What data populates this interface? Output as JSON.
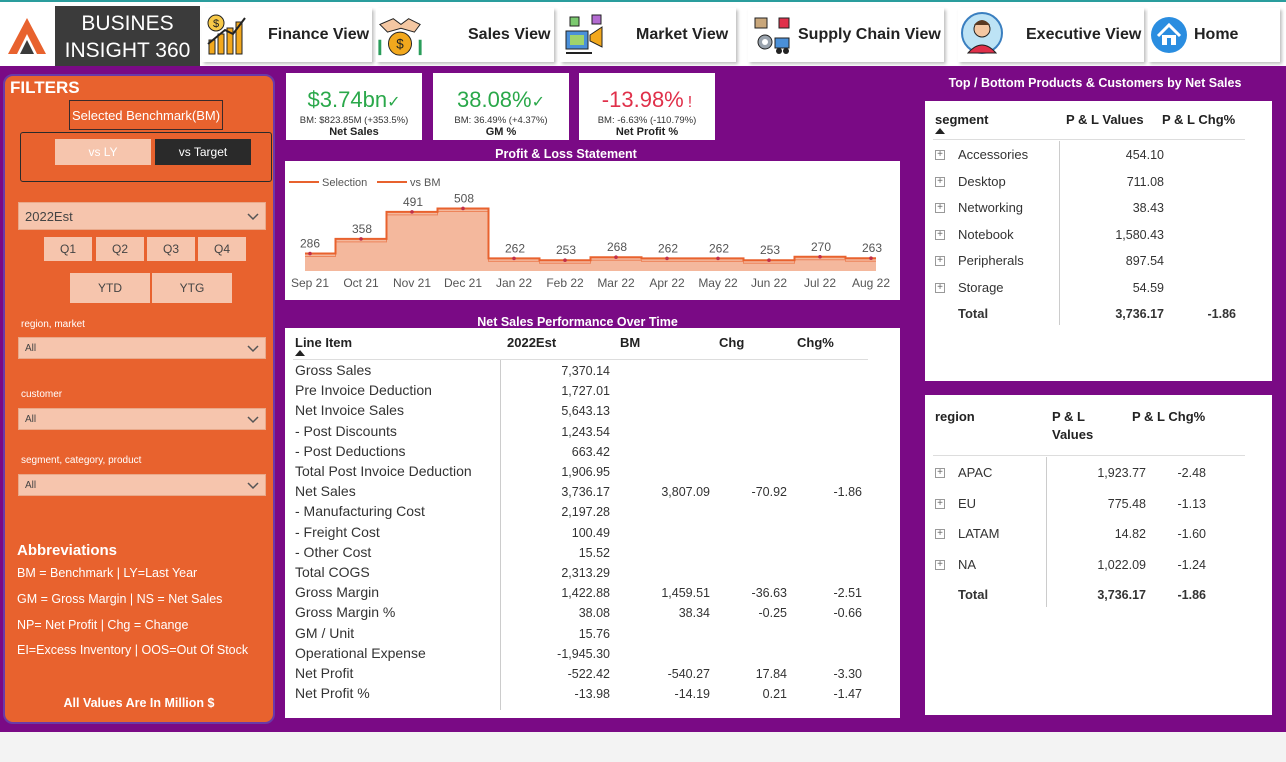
{
  "app": {
    "brand_line1": "BUSINES",
    "brand_line2": "INSIGHT 360",
    "logo_icon": "logo-a-icon"
  },
  "nav": [
    {
      "label": "Finance View",
      "icon": "finance-chart-icon"
    },
    {
      "label": "Sales View",
      "icon": "handshake-coin-icon"
    },
    {
      "label": "Market View",
      "icon": "market-icon"
    },
    {
      "label": "Supply Chain View",
      "icon": "supply-chain-icon"
    },
    {
      "label": "Executive View",
      "icon": "executive-icon"
    },
    {
      "label": "Home",
      "icon": "home-icon"
    }
  ],
  "filters": {
    "title": "FILTERS",
    "benchmark_label": "Selected Benchmark(BM)",
    "toggle_off": "vs LY",
    "toggle_on": "vs Target",
    "year": "2022Est",
    "quarters": [
      "Q1",
      "Q2",
      "Q3",
      "Q4"
    ],
    "ytd": "YTD",
    "ytg": "YTG",
    "region_label": "region, market",
    "region_value": "All",
    "customer_label": "customer",
    "customer_value": "All",
    "segment_label": "segment, category, product",
    "segment_value": "All",
    "abbr_title": "Abbreviations",
    "abbr": [
      "BM = Benchmark | LY=Last Year",
      "GM = Gross Margin | NS = Net Sales",
      "NP= Net Profit | Chg = Change",
      "EI=Excess Inventory | OOS=Out Of Stock"
    ],
    "note": "All Values Are In Million $"
  },
  "kpis": [
    {
      "value": "$3.74bn",
      "mark": "✓",
      "sub": "BM: $823.85M (+353.5%)",
      "name": "Net Sales",
      "color": "#2aa84a"
    },
    {
      "value": "38.08%",
      "mark": "✓",
      "sub": "BM: 36.49% (+4.37%)",
      "name": "GM %",
      "color": "#2aa84a"
    },
    {
      "value": "-13.98%",
      "mark": "!",
      "sub": "BM: -6.63% (-110.79%)",
      "name": "Net Profit %",
      "color": "#e0304a"
    }
  ],
  "pl_title": "Profit & Loss Statement",
  "chart_data": {
    "type": "area",
    "legend": [
      "Selection",
      "vs BM"
    ],
    "categories": [
      "Sep 21",
      "Oct 21",
      "Nov 21",
      "Dec 21",
      "Jan 22",
      "Feb 22",
      "Mar 22",
      "Apr 22",
      "May 22",
      "Jun 22",
      "Jul 22",
      "Aug 22"
    ],
    "series": [
      {
        "name": "Selection",
        "values": [
          286,
          358,
          491,
          508,
          262,
          253,
          268,
          262,
          262,
          253,
          270,
          263
        ]
      },
      {
        "name": "vs BM",
        "values": [
          286,
          358,
          491,
          508,
          262,
          253,
          268,
          262,
          262,
          253,
          270,
          263
        ]
      }
    ],
    "colors": {
      "line": "#e8622e",
      "fill": "#f4b89d"
    }
  },
  "table_title": "Net Sales Performance Over Time",
  "table": {
    "headers": [
      "Line Item",
      "2022Est",
      "BM",
      "Chg",
      "Chg%"
    ],
    "rows": [
      {
        "item": "Gross Sales",
        "est": "7,370.14",
        "bm": "",
        "chg": "",
        "pct": ""
      },
      {
        "item": "Pre Invoice Deduction",
        "est": "1,727.01",
        "bm": "",
        "chg": "",
        "pct": ""
      },
      {
        "item": "Net Invoice Sales",
        "est": "5,643.13",
        "bm": "",
        "chg": "",
        "pct": ""
      },
      {
        "item": "- Post Discounts",
        "est": "1,243.54",
        "bm": "",
        "chg": "",
        "pct": ""
      },
      {
        "item": "- Post Deductions",
        "est": "663.42",
        "bm": "",
        "chg": "",
        "pct": ""
      },
      {
        "item": "Total Post Invoice Deduction",
        "est": "1,906.95",
        "bm": "",
        "chg": "",
        "pct": ""
      },
      {
        "item": "Net Sales",
        "est": "3,736.17",
        "bm": "3,807.09",
        "chg": "-70.92",
        "pct": "-1.86"
      },
      {
        "item": "- Manufacturing Cost",
        "est": "2,197.28",
        "bm": "",
        "chg": "",
        "pct": ""
      },
      {
        "item": "- Freight Cost",
        "est": "100.49",
        "bm": "",
        "chg": "",
        "pct": ""
      },
      {
        "item": "- Other Cost",
        "est": "15.52",
        "bm": "",
        "chg": "",
        "pct": ""
      },
      {
        "item": "Total COGS",
        "est": "2,313.29",
        "bm": "",
        "chg": "",
        "pct": ""
      },
      {
        "item": "Gross Margin",
        "est": "1,422.88",
        "bm": "1,459.51",
        "chg": "-36.63",
        "pct": "-2.51"
      },
      {
        "item": "Gross Margin %",
        "est": "38.08",
        "bm": "38.34",
        "chg": "-0.25",
        "pct": "-0.66"
      },
      {
        "item": "GM / Unit",
        "est": "15.76",
        "bm": "",
        "chg": "",
        "pct": ""
      },
      {
        "item": "Operational Expense",
        "est": "-1,945.30",
        "bm": "",
        "chg": "",
        "pct": ""
      },
      {
        "item": "Net Profit",
        "est": "-522.42",
        "bm": "-540.27",
        "chg": "17.84",
        "pct": "-3.30"
      },
      {
        "item": "Net Profit %",
        "est": "-13.98",
        "bm": "-14.19",
        "chg": "0.21",
        "pct": "-1.47"
      }
    ]
  },
  "top_title": "Top / Bottom Products & Customers by Net Sales",
  "segment_table": {
    "headers": [
      "segment",
      "P & L Values",
      "P & L Chg%"
    ],
    "rows": [
      {
        "name": "Accessories",
        "v": "454.10",
        "c": ""
      },
      {
        "name": "Desktop",
        "v": "711.08",
        "c": ""
      },
      {
        "name": "Networking",
        "v": "38.43",
        "c": ""
      },
      {
        "name": "Notebook",
        "v": "1,580.43",
        "c": ""
      },
      {
        "name": "Peripherals",
        "v": "897.54",
        "c": ""
      },
      {
        "name": "Storage",
        "v": "54.59",
        "c": ""
      }
    ],
    "total": {
      "name": "Total",
      "v": "3,736.17",
      "c": "-1.86"
    }
  },
  "region_table": {
    "headers": [
      "region",
      "P & L",
      "Values",
      "P & L Chg%"
    ],
    "rows": [
      {
        "name": "APAC",
        "v": "1,923.77",
        "c": "-2.48"
      },
      {
        "name": "EU",
        "v": "775.48",
        "c": "-1.13"
      },
      {
        "name": "LATAM",
        "v": "14.82",
        "c": "-1.60"
      },
      {
        "name": "NA",
        "v": "1,022.09",
        "c": "-1.24"
      }
    ],
    "total": {
      "name": "Total",
      "v": "3,736.17",
      "c": "-1.86"
    }
  }
}
